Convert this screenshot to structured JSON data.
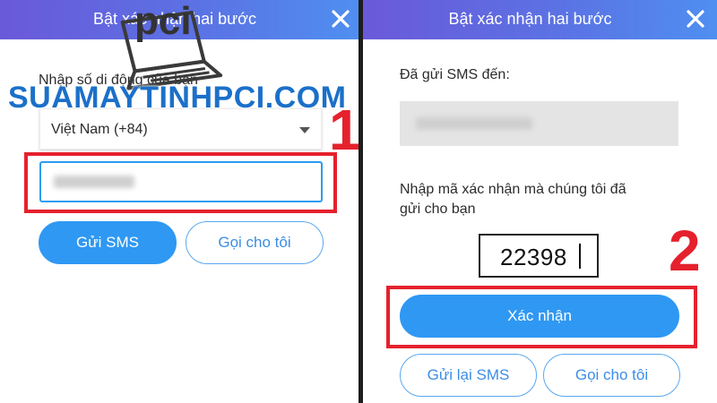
{
  "left_panel": {
    "title": "Bật xác nhận hai bước",
    "prompt": "Nhập số di động của bạn",
    "country_select": "Việt Nam (+84)",
    "send_sms_button": "Gửi SMS",
    "call_me_button": "Gọi cho tôi",
    "step_number": "1"
  },
  "right_panel": {
    "title": "Bật xác nhận hai bước",
    "sms_sent_label": "Đã gửi SMS đến:",
    "code_prompt_line1": "Nhập mã xác nhận mà chúng tôi đã",
    "code_prompt_line2": "gửi cho bạn",
    "code_value": "22398",
    "confirm_button": "Xác nhận",
    "resend_sms_button": "Gửi lại SMS",
    "call_me_button": "Gọi cho tôi",
    "step_number": "2"
  },
  "watermark": {
    "logo_text": "pci",
    "site_text": "SUAMAYTINHPCI.COM"
  },
  "colors": {
    "header_gradient_start": "#6a59d9",
    "header_gradient_end": "#4f8ff0",
    "primary_button": "#2f98f3",
    "outline_button_text": "#3d8de5",
    "highlight_red": "#e5212d",
    "watermark_blue": "#1b70c9"
  },
  "icons": {
    "close": "close-icon",
    "dropdown": "chevron-down-icon",
    "logo": "laptop-logo-icon"
  }
}
